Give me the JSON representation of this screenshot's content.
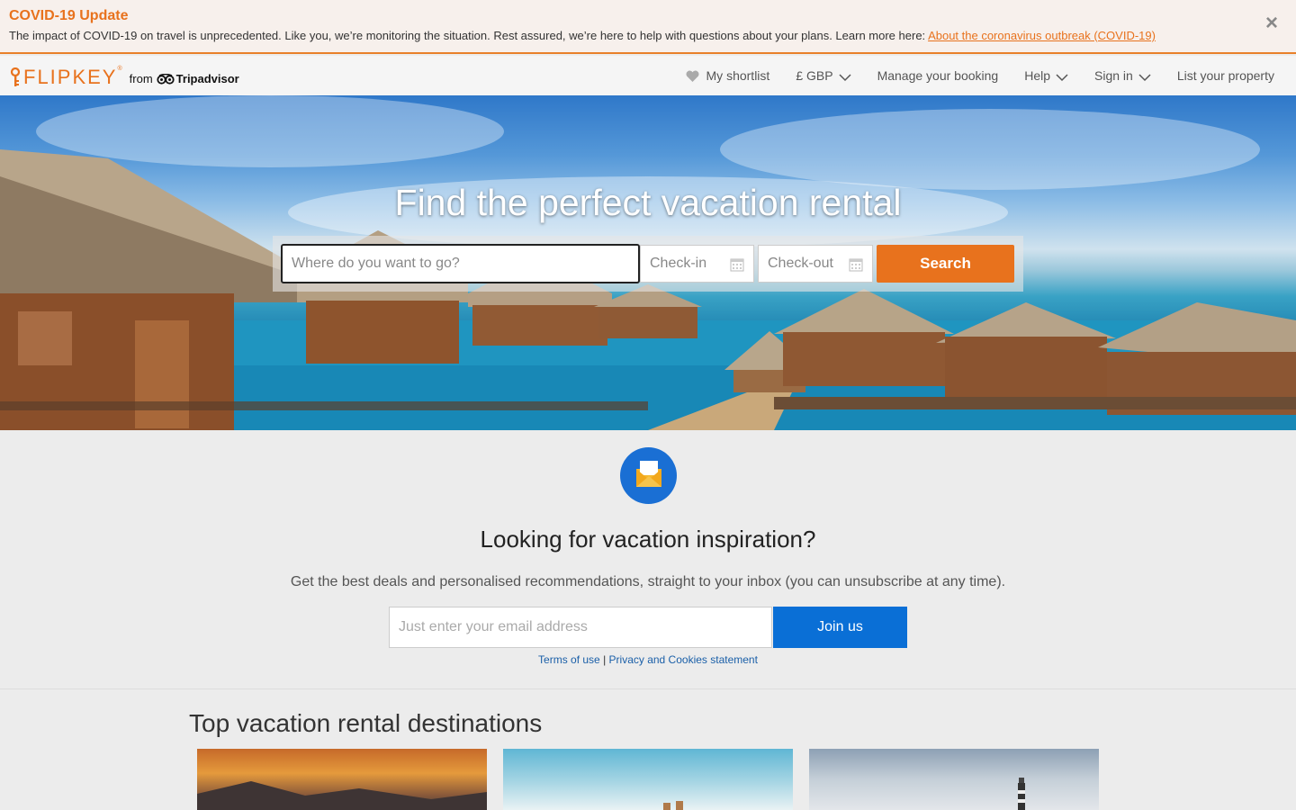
{
  "covid": {
    "title": "COVID-19 Update",
    "text": "The impact of COVID-19 on travel is unprecedented. Like you, we’re monitoring the situation. Rest assured, we’re here to help with questions about your plans. Learn more here: ",
    "link": "About the coronavirus outbreak (COVID-19)",
    "close": "×"
  },
  "header": {
    "logo_word": "FLIPKEY",
    "logo_reg": "®",
    "logo_from": "from",
    "logo_brand": "Tripadvisor",
    "nav": {
      "shortlist": "My shortlist",
      "currency": "£ GBP",
      "manage": "Manage your booking",
      "help": "Help",
      "signin": "Sign in",
      "list": "List your property"
    }
  },
  "hero": {
    "title": "Find the perfect vacation rental",
    "where_placeholder": "Where do you want to go?",
    "checkin": "Check-in",
    "checkout": "Check-out",
    "search_label": "Search"
  },
  "newsletter": {
    "title": "Looking for vacation inspiration?",
    "subtitle": "Get the best deals and personalised recommendations, straight to your inbox (you can unsubscribe at any time).",
    "email_placeholder": "Just enter your email address",
    "join_label": "Join us",
    "terms": "Terms of use",
    "separator": " | ",
    "privacy": "Privacy and Cookies statement"
  },
  "destinations": {
    "title": "Top vacation rental destinations"
  },
  "colors": {
    "brand_orange": "#e8721d",
    "join_blue": "#0a6fd6",
    "mail_blue": "#1a6fd4"
  }
}
